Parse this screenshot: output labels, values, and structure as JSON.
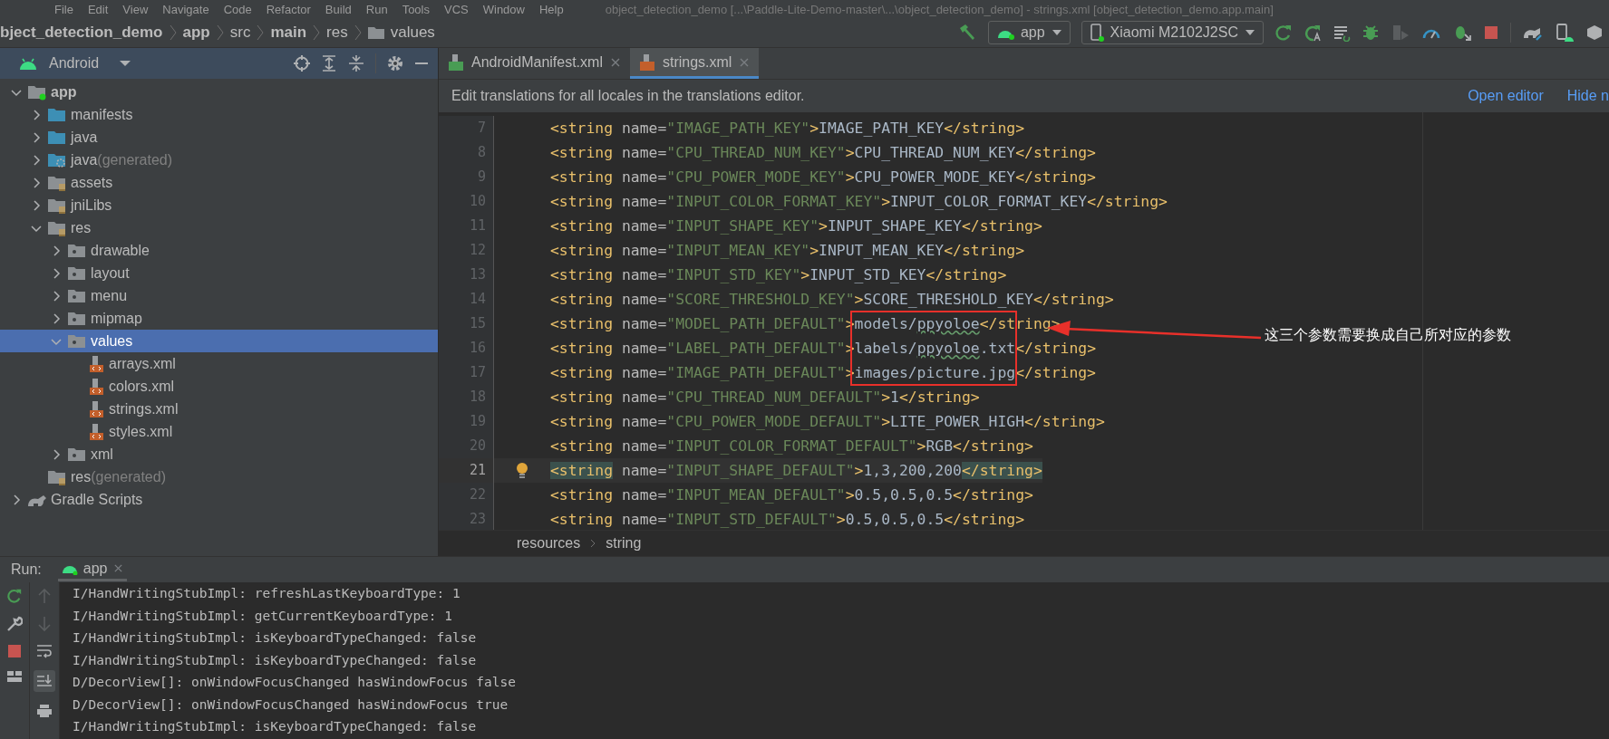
{
  "menu_bar": {
    "items": [
      "File",
      "Edit",
      "View",
      "Navigate",
      "Code",
      "Refactor",
      "Build",
      "Run",
      "Tools",
      "VCS",
      "Window",
      "Help"
    ],
    "title": "object_detection_demo [...\\Paddle-Lite-Demo-master\\...\\object_detection_demo] - strings.xml [object_detection_demo.app.main]"
  },
  "breadcrumb": [
    {
      "label": "bject_detection_demo",
      "bold": true
    },
    {
      "label": "app",
      "bold": true
    },
    {
      "label": "src",
      "bold": false
    },
    {
      "label": "main",
      "bold": true
    },
    {
      "label": "res",
      "bold": false
    },
    {
      "label": "values",
      "bold": false,
      "kind": "folder"
    }
  ],
  "toolbar": {
    "run_config": "app",
    "device": "Xiaomi M2102J2SC"
  },
  "sidebar": {
    "view": "Android",
    "tree": [
      {
        "label": "app",
        "kind": "module",
        "expanded": true,
        "selected": false,
        "children": [
          {
            "label": "manifests",
            "kind": "folder",
            "expanded": false,
            "selected": false
          },
          {
            "label": "java",
            "kind": "folder",
            "expanded": false,
            "selected": false
          },
          {
            "label": "java",
            "suffix": "(generated)",
            "kind": "generated",
            "expanded": false,
            "selected": false
          },
          {
            "label": "assets",
            "kind": "resource",
            "expanded": false,
            "selected": false
          },
          {
            "label": "jniLibs",
            "kind": "resource",
            "expanded": false,
            "selected": false
          },
          {
            "label": "res",
            "kind": "resource",
            "expanded": true,
            "selected": false,
            "children": [
              {
                "label": "drawable",
                "kind": "package",
                "expanded": false,
                "selected": false
              },
              {
                "label": "layout",
                "kind": "package",
                "expanded": false,
                "selected": false
              },
              {
                "label": "menu",
                "kind": "package",
                "expanded": false,
                "selected": false
              },
              {
                "label": "mipmap",
                "kind": "package",
                "expanded": false,
                "selected": false
              },
              {
                "label": "values",
                "kind": "package",
                "expanded": true,
                "selected": true,
                "children": [
                  {
                    "label": "arrays.xml",
                    "kind": "xml",
                    "selected": false
                  },
                  {
                    "label": "colors.xml",
                    "kind": "xml",
                    "selected": false
                  },
                  {
                    "label": "strings.xml",
                    "kind": "xml",
                    "selected": false
                  },
                  {
                    "label": "styles.xml",
                    "kind": "xml",
                    "selected": false
                  }
                ]
              },
              {
                "label": "xml",
                "kind": "package",
                "expanded": false,
                "selected": false
              }
            ]
          },
          {
            "label": "res",
            "suffix": "(generated)",
            "kind": "resource",
            "selected": false
          }
        ]
      },
      {
        "label": "Gradle Scripts",
        "kind": "gradle",
        "expanded": false,
        "selected": false
      }
    ]
  },
  "editor": {
    "tabs": [
      {
        "label": "AndroidManifest.xml",
        "kind": "manifest",
        "selected": false
      },
      {
        "label": "strings.xml",
        "kind": "xml",
        "selected": true
      }
    ],
    "notice": {
      "text": "Edit translations for all locales in the translations editor.",
      "links": [
        "Open editor",
        "Hide n"
      ]
    },
    "lines": [
      {
        "number": "7",
        "current": false,
        "tokens": [
          {
            "kind": "tag",
            "text": "<string"
          },
          {
            "kind": "attr",
            "text": " name="
          },
          {
            "kind": "str",
            "text": "\"IMAGE_PATH_KEY\""
          },
          {
            "kind": "tag",
            "text": ">"
          },
          {
            "kind": "text",
            "text": "IMAGE_PATH_KEY"
          },
          {
            "kind": "tag",
            "text": "</string>"
          }
        ]
      },
      {
        "number": "8",
        "current": false,
        "tokens": [
          {
            "kind": "tag",
            "text": "<string"
          },
          {
            "kind": "attr",
            "text": " name="
          },
          {
            "kind": "str",
            "text": "\"CPU_THREAD_NUM_KEY\""
          },
          {
            "kind": "tag",
            "text": ">"
          },
          {
            "kind": "text",
            "text": "CPU_THREAD_NUM_KEY"
          },
          {
            "kind": "tag",
            "text": "</string>"
          }
        ]
      },
      {
        "number": "9",
        "current": false,
        "tokens": [
          {
            "kind": "tag",
            "text": "<string"
          },
          {
            "kind": "attr",
            "text": " name="
          },
          {
            "kind": "str",
            "text": "\"CPU_POWER_MODE_KEY\""
          },
          {
            "kind": "tag",
            "text": ">"
          },
          {
            "kind": "text",
            "text": "CPU_POWER_MODE_KEY"
          },
          {
            "kind": "tag",
            "text": "</string>"
          }
        ]
      },
      {
        "number": "10",
        "current": false,
        "tokens": [
          {
            "kind": "tag",
            "text": "<string"
          },
          {
            "kind": "attr",
            "text": " name="
          },
          {
            "kind": "str",
            "text": "\"INPUT_COLOR_FORMAT_KEY\""
          },
          {
            "kind": "tag",
            "text": ">"
          },
          {
            "kind": "text",
            "text": "INPUT_COLOR_FORMAT_KEY"
          },
          {
            "kind": "tag",
            "text": "</string>"
          }
        ]
      },
      {
        "number": "11",
        "current": false,
        "tokens": [
          {
            "kind": "tag",
            "text": "<string"
          },
          {
            "kind": "attr",
            "text": " name="
          },
          {
            "kind": "str",
            "text": "\"INPUT_SHAPE_KEY\""
          },
          {
            "kind": "tag",
            "text": ">"
          },
          {
            "kind": "text",
            "text": "INPUT_SHAPE_KEY"
          },
          {
            "kind": "tag",
            "text": "</string>"
          }
        ]
      },
      {
        "number": "12",
        "current": false,
        "tokens": [
          {
            "kind": "tag",
            "text": "<string"
          },
          {
            "kind": "attr",
            "text": " name="
          },
          {
            "kind": "str",
            "text": "\"INPUT_MEAN_KEY\""
          },
          {
            "kind": "tag",
            "text": ">"
          },
          {
            "kind": "text",
            "text": "INPUT_MEAN_KEY"
          },
          {
            "kind": "tag",
            "text": "</string>"
          }
        ]
      },
      {
        "number": "13",
        "current": false,
        "tokens": [
          {
            "kind": "tag",
            "text": "<string"
          },
          {
            "kind": "attr",
            "text": " name="
          },
          {
            "kind": "str",
            "text": "\"INPUT_STD_KEY\""
          },
          {
            "kind": "tag",
            "text": ">"
          },
          {
            "kind": "text",
            "text": "INPUT_STD_KEY"
          },
          {
            "kind": "tag",
            "text": "</string>"
          }
        ]
      },
      {
        "number": "14",
        "current": false,
        "tokens": [
          {
            "kind": "tag",
            "text": "<string"
          },
          {
            "kind": "attr",
            "text": " name="
          },
          {
            "kind": "str",
            "text": "\"SCORE_THRESHOLD_KEY\""
          },
          {
            "kind": "tag",
            "text": ">"
          },
          {
            "kind": "text",
            "text": "SCORE_THRESHOLD_KEY"
          },
          {
            "kind": "tag",
            "text": "</string>"
          }
        ]
      },
      {
        "number": "15",
        "current": false,
        "tokens": [
          {
            "kind": "tag",
            "text": "<string"
          },
          {
            "kind": "attr",
            "text": " name="
          },
          {
            "kind": "str",
            "text": "\"MODEL_PATH_DEFAULT\""
          },
          {
            "kind": "tag",
            "text": ">"
          },
          {
            "kind": "text",
            "text": "models/"
          },
          {
            "kind": "typo",
            "text": "ppyoloe"
          },
          {
            "kind": "tag",
            "text": "</string>"
          }
        ]
      },
      {
        "number": "16",
        "current": false,
        "tokens": [
          {
            "kind": "tag",
            "text": "<string"
          },
          {
            "kind": "attr",
            "text": " name="
          },
          {
            "kind": "str",
            "text": "\"LABEL_PATH_DEFAULT\""
          },
          {
            "kind": "tag",
            "text": ">"
          },
          {
            "kind": "text",
            "text": "labels/"
          },
          {
            "kind": "typo",
            "text": "ppyoloe"
          },
          {
            "kind": "text",
            "text": ".txt"
          },
          {
            "kind": "tag",
            "text": "</string>"
          }
        ]
      },
      {
        "number": "17",
        "current": false,
        "tokens": [
          {
            "kind": "tag",
            "text": "<string"
          },
          {
            "kind": "attr",
            "text": " name="
          },
          {
            "kind": "str",
            "text": "\"IMAGE_PATH_DEFAULT\""
          },
          {
            "kind": "tag",
            "text": ">"
          },
          {
            "kind": "text",
            "text": "images/picture.jpg"
          },
          {
            "kind": "tag",
            "text": "</string>"
          }
        ]
      },
      {
        "number": "18",
        "current": false,
        "tokens": [
          {
            "kind": "tag",
            "text": "<string"
          },
          {
            "kind": "attr",
            "text": " name="
          },
          {
            "kind": "str",
            "text": "\"CPU_THREAD_NUM_DEFAULT\""
          },
          {
            "kind": "tag",
            "text": ">"
          },
          {
            "kind": "text",
            "text": "1"
          },
          {
            "kind": "tag",
            "text": "</string>"
          }
        ]
      },
      {
        "number": "19",
        "current": false,
        "tokens": [
          {
            "kind": "tag",
            "text": "<string"
          },
          {
            "kind": "attr",
            "text": " name="
          },
          {
            "kind": "str",
            "text": "\"CPU_POWER_MODE_DEFAULT\""
          },
          {
            "kind": "tag",
            "text": ">"
          },
          {
            "kind": "text",
            "text": "LITE_POWER_HIGH"
          },
          {
            "kind": "tag",
            "text": "</string>"
          }
        ]
      },
      {
        "number": "20",
        "current": false,
        "tokens": [
          {
            "kind": "tag",
            "text": "<string"
          },
          {
            "kind": "attr",
            "text": " name="
          },
          {
            "kind": "str",
            "text": "\"INPUT_COLOR_FORMAT_DEFAULT\""
          },
          {
            "kind": "tag",
            "text": ">"
          },
          {
            "kind": "text",
            "text": "RGB"
          },
          {
            "kind": "tag",
            "text": "</string>"
          }
        ]
      },
      {
        "number": "21",
        "current": true,
        "tokens": [
          {
            "kind": "tag-match",
            "text": "<string"
          },
          {
            "kind": "attr",
            "text": " name="
          },
          {
            "kind": "str",
            "text": "\"INPUT_SHAPE_DEFAULT\""
          },
          {
            "kind": "tag",
            "text": ">"
          },
          {
            "kind": "text",
            "text": "1,3,200,200"
          },
          {
            "kind": "tag-match",
            "text": "</string>"
          }
        ]
      },
      {
        "number": "22",
        "current": false,
        "tokens": [
          {
            "kind": "tag",
            "text": "<string"
          },
          {
            "kind": "attr",
            "text": " name="
          },
          {
            "kind": "str",
            "text": "\"INPUT_MEAN_DEFAULT\""
          },
          {
            "kind": "tag",
            "text": ">"
          },
          {
            "kind": "text",
            "text": "0.5,0.5,0.5"
          },
          {
            "kind": "tag",
            "text": "</string>"
          }
        ]
      },
      {
        "number": "23",
        "current": false,
        "tokens": [
          {
            "kind": "tag",
            "text": "<string"
          },
          {
            "kind": "attr",
            "text": " name="
          },
          {
            "kind": "str",
            "text": "\"INPUT_STD_DEFAULT\""
          },
          {
            "kind": "tag",
            "text": ">"
          },
          {
            "kind": "text",
            "text": "0.5,0.5,0.5"
          },
          {
            "kind": "tag",
            "text": "</string>"
          }
        ]
      }
    ],
    "annotation": "这三个参数需要换成自己所对应的参数",
    "footer": [
      "resources",
      "string"
    ]
  },
  "run_panel": {
    "label": "Run:",
    "tab": "app",
    "log": [
      "I/HandWritingStubImpl: refreshLastKeyboardType: 1",
      "I/HandWritingStubImpl: getCurrentKeyboardType: 1",
      "I/HandWritingStubImpl: isKeyboardTypeChanged: false",
      "I/HandWritingStubImpl: isKeyboardTypeChanged: false",
      "D/DecorView[]: onWindowFocusChanged hasWindowFocus false",
      "D/DecorView[]: onWindowFocusChanged hasWindowFocus true",
      "I/HandWritingStubImpl: isKeyboardTypeChanged: false"
    ]
  }
}
